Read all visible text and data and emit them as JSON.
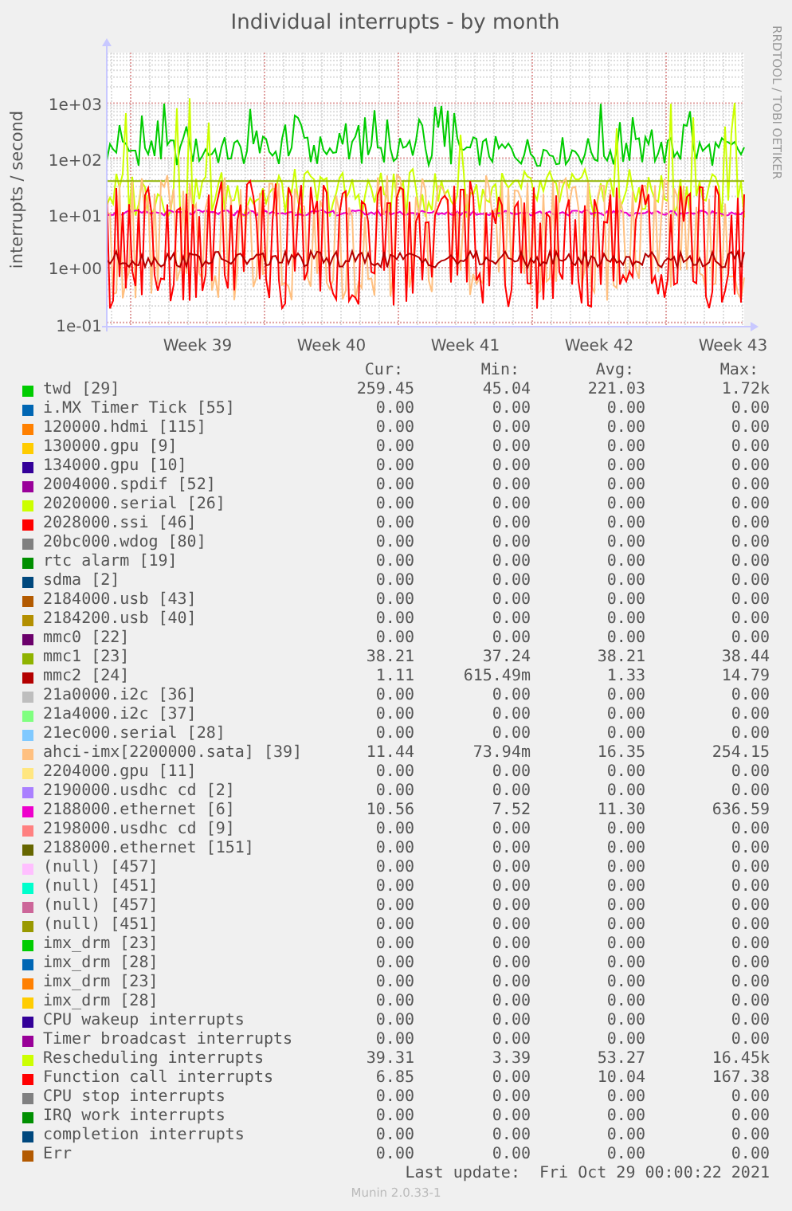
{
  "title": "Individual interrupts - by month",
  "side_label": "RRDTOOL / TOBI OETIKER",
  "graph": {
    "y_axis_label": "interrupts / second",
    "y_tick_labels": [
      "1e+03",
      "1e+02",
      "1e+01",
      "1e+00",
      "1e-01"
    ],
    "x_tick_labels": [
      "Week 39",
      "Week 40",
      "Week 41",
      "Week 42",
      "Week 43"
    ]
  },
  "legend": {
    "columns": [
      "Cur:",
      "Min:",
      "Avg:",
      "Max:"
    ],
    "rows": [
      {
        "name": "twd [29]",
        "color": "#00cc00",
        "cur": "259.45",
        "min": "45.04",
        "avg": "221.03",
        "max": "1.72k"
      },
      {
        "name": "i.MX Timer Tick [55]",
        "color": "#0066b3",
        "cur": "0.00",
        "min": "0.00",
        "avg": "0.00",
        "max": "0.00"
      },
      {
        "name": "120000.hdmi [115]",
        "color": "#ff8000",
        "cur": "0.00",
        "min": "0.00",
        "avg": "0.00",
        "max": "0.00"
      },
      {
        "name": "130000.gpu [9]",
        "color": "#ffcc00",
        "cur": "0.00",
        "min": "0.00",
        "avg": "0.00",
        "max": "0.00"
      },
      {
        "name": "134000.gpu [10]",
        "color": "#330099",
        "cur": "0.00",
        "min": "0.00",
        "avg": "0.00",
        "max": "0.00"
      },
      {
        "name": "2004000.spdif [52]",
        "color": "#990099",
        "cur": "0.00",
        "min": "0.00",
        "avg": "0.00",
        "max": "0.00"
      },
      {
        "name": "2020000.serial [26]",
        "color": "#ccff00",
        "cur": "0.00",
        "min": "0.00",
        "avg": "0.00",
        "max": "0.00"
      },
      {
        "name": "2028000.ssi [46]",
        "color": "#ff0000",
        "cur": "0.00",
        "min": "0.00",
        "avg": "0.00",
        "max": "0.00"
      },
      {
        "name": "20bc000.wdog [80]",
        "color": "#808080",
        "cur": "0.00",
        "min": "0.00",
        "avg": "0.00",
        "max": "0.00"
      },
      {
        "name": "rtc alarm [19]",
        "color": "#008f00",
        "cur": "0.00",
        "min": "0.00",
        "avg": "0.00",
        "max": "0.00"
      },
      {
        "name": "sdma [2]",
        "color": "#00487d",
        "cur": "0.00",
        "min": "0.00",
        "avg": "0.00",
        "max": "0.00"
      },
      {
        "name": "2184000.usb [43]",
        "color": "#b35a00",
        "cur": "0.00",
        "min": "0.00",
        "avg": "0.00",
        "max": "0.00"
      },
      {
        "name": "2184200.usb [40]",
        "color": "#b38f00",
        "cur": "0.00",
        "min": "0.00",
        "avg": "0.00",
        "max": "0.00"
      },
      {
        "name": "mmc0 [22]",
        "color": "#6b006b",
        "cur": "0.00",
        "min": "0.00",
        "avg": "0.00",
        "max": "0.00"
      },
      {
        "name": "mmc1 [23]",
        "color": "#8fb300",
        "cur": "38.21",
        "min": "37.24",
        "avg": "38.21",
        "max": "38.44"
      },
      {
        "name": "mmc2 [24]",
        "color": "#b30000",
        "cur": "1.11",
        "min": "615.49m",
        "avg": "1.33",
        "max": "14.79"
      },
      {
        "name": "21a0000.i2c [36]",
        "color": "#bebebe",
        "cur": "0.00",
        "min": "0.00",
        "avg": "0.00",
        "max": "0.00"
      },
      {
        "name": "21a4000.i2c [37]",
        "color": "#80ff80",
        "cur": "0.00",
        "min": "0.00",
        "avg": "0.00",
        "max": "0.00"
      },
      {
        "name": "21ec000.serial [28]",
        "color": "#80c9ff",
        "cur": "0.00",
        "min": "0.00",
        "avg": "0.00",
        "max": "0.00"
      },
      {
        "name": "ahci-imx[2200000.sata] [39]",
        "color": "#ffc080",
        "cur": "11.44",
        "min": "73.94m",
        "avg": "16.35",
        "max": "254.15"
      },
      {
        "name": "2204000.gpu [11]",
        "color": "#ffe680",
        "cur": "0.00",
        "min": "0.00",
        "avg": "0.00",
        "max": "0.00"
      },
      {
        "name": "2190000.usdhc cd [2]",
        "color": "#aa80ff",
        "cur": "0.00",
        "min": "0.00",
        "avg": "0.00",
        "max": "0.00"
      },
      {
        "name": "2188000.ethernet [6]",
        "color": "#ee00cc",
        "cur": "10.56",
        "min": "7.52",
        "avg": "11.30",
        "max": "636.59"
      },
      {
        "name": "2198000.usdhc cd [9]",
        "color": "#ff8080",
        "cur": "0.00",
        "min": "0.00",
        "avg": "0.00",
        "max": "0.00"
      },
      {
        "name": "2188000.ethernet [151]",
        "color": "#666600",
        "cur": "0.00",
        "min": "0.00",
        "avg": "0.00",
        "max": "0.00"
      },
      {
        "name": "(null) [457]",
        "color": "#ffbfff",
        "cur": "0.00",
        "min": "0.00",
        "avg": "0.00",
        "max": "0.00"
      },
      {
        "name": "(null) [451]",
        "color": "#00ffcc",
        "cur": "0.00",
        "min": "0.00",
        "avg": "0.00",
        "max": "0.00"
      },
      {
        "name": "(null) [457]",
        "color": "#cc6699",
        "cur": "0.00",
        "min": "0.00",
        "avg": "0.00",
        "max": "0.00"
      },
      {
        "name": "(null) [451]",
        "color": "#999900",
        "cur": "0.00",
        "min": "0.00",
        "avg": "0.00",
        "max": "0.00"
      },
      {
        "name": "imx_drm [23]",
        "color": "#00cc01",
        "cur": "0.00",
        "min": "0.00",
        "avg": "0.00",
        "max": "0.00"
      },
      {
        "name": "imx_drm [28]",
        "color": "#0066b4",
        "cur": "0.00",
        "min": "0.00",
        "avg": "0.00",
        "max": "0.00"
      },
      {
        "name": "imx_drm [23]",
        "color": "#ff8001",
        "cur": "0.00",
        "min": "0.00",
        "avg": "0.00",
        "max": "0.00"
      },
      {
        "name": "imx_drm [28]",
        "color": "#ffcc01",
        "cur": "0.00",
        "min": "0.00",
        "avg": "0.00",
        "max": "0.00"
      },
      {
        "name": "CPU wakeup interrupts",
        "color": "#330098",
        "cur": "0.00",
        "min": "0.00",
        "avg": "0.00",
        "max": "0.00"
      },
      {
        "name": "Timer broadcast interrupts",
        "color": "#990098",
        "cur": "0.00",
        "min": "0.00",
        "avg": "0.00",
        "max": "0.00"
      },
      {
        "name": "Rescheduling interrupts",
        "color": "#ccff01",
        "cur": "39.31",
        "min": "3.39",
        "avg": "53.27",
        "max": "16.45k"
      },
      {
        "name": "Function call interrupts",
        "color": "#ff0001",
        "cur": "6.85",
        "min": "0.00",
        "avg": "10.04",
        "max": "167.38"
      },
      {
        "name": "CPU stop interrupts",
        "color": "#808081",
        "cur": "0.00",
        "min": "0.00",
        "avg": "0.00",
        "max": "0.00"
      },
      {
        "name": "IRQ work interrupts",
        "color": "#008f01",
        "cur": "0.00",
        "min": "0.00",
        "avg": "0.00",
        "max": "0.00"
      },
      {
        "name": "completion interrupts",
        "color": "#00487e",
        "cur": "0.00",
        "min": "0.00",
        "avg": "0.00",
        "max": "0.00"
      },
      {
        "name": "Err",
        "color": "#b35a01",
        "cur": "0.00",
        "min": "0.00",
        "avg": "0.00",
        "max": "0.00"
      }
    ]
  },
  "last_update": "Last update:  Fri Oct 29 00:00:22 2021",
  "footer": "Munin 2.0.33-1"
}
